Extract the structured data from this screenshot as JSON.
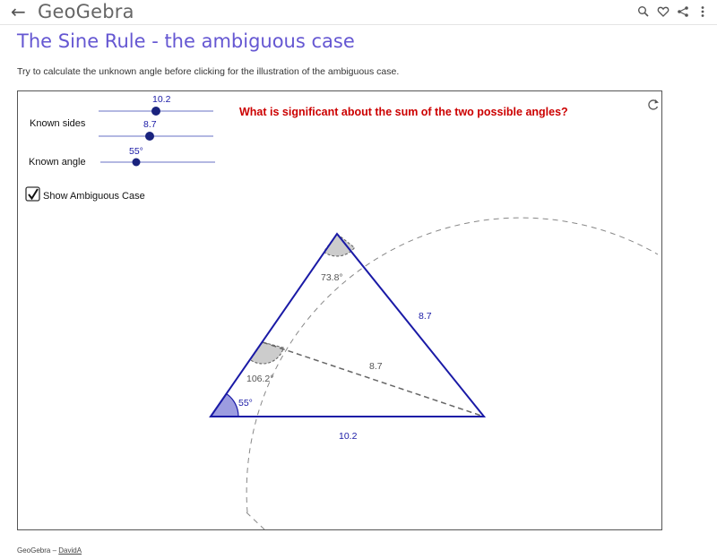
{
  "topbar": {
    "logo_text": "GeoGebra",
    "icons": [
      "back-arrow-icon",
      "search-icon",
      "heart-icon",
      "share-icon",
      "more-vert-icon"
    ]
  },
  "page": {
    "title": "The Sine Rule - the ambiguous case",
    "subtitle": "Try to calculate the unknown angle before clicking for the illustration of the ambiguous case."
  },
  "applet": {
    "sliders": {
      "known_sides_label": "Known sides",
      "side1_value": "10.2",
      "side2_value": "8.7",
      "known_angle_label": "Known angle",
      "angle_value": "55°",
      "side1_fraction": 0.5,
      "side2_fraction": 0.44,
      "angle_fraction": 0.33
    },
    "checkbox": {
      "label": "Show Ambiguous Case",
      "checked": true
    },
    "question": "What is significant about the sum of the two possible angles?",
    "triangle": {
      "base_label": "10.2",
      "right_side_label": "8.7",
      "dashed_side_label": "8.7",
      "angle_bottom_left": "55°",
      "angle_top": "73.8°",
      "angle_obtuse": "106.2°"
    },
    "colors": {
      "triangle": "#1a1aa6",
      "question": "#cc0000",
      "slider_track": "#9aa0d8",
      "slider_knob": "#1a237e",
      "angle_fill_blue": "#9c9ce0",
      "angle_fill_grey": "#cccccc"
    }
  },
  "footer": {
    "brand": "GeoGebra",
    "separator": " – ",
    "author": "DavidA"
  }
}
